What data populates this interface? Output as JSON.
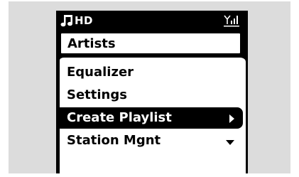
{
  "status_bar": {
    "music_icon": "music-note-icon",
    "source": "HD",
    "signal_icon": "signal-strength-icon"
  },
  "menu": {
    "title": "Artists",
    "items": [
      {
        "label": "Equalizer",
        "selected": false
      },
      {
        "label": "Settings",
        "selected": false
      },
      {
        "label": "Create Playlist",
        "selected": true,
        "indicator": "arrow-right-icon"
      },
      {
        "label": "Station Mgnt",
        "selected": false,
        "indicator": "scroll-down-arrow-icon"
      }
    ]
  },
  "colors": {
    "screen_background": "#000000",
    "list_background": "#ffffff",
    "highlight": "#000000",
    "backdrop": "#dcdcdc"
  }
}
